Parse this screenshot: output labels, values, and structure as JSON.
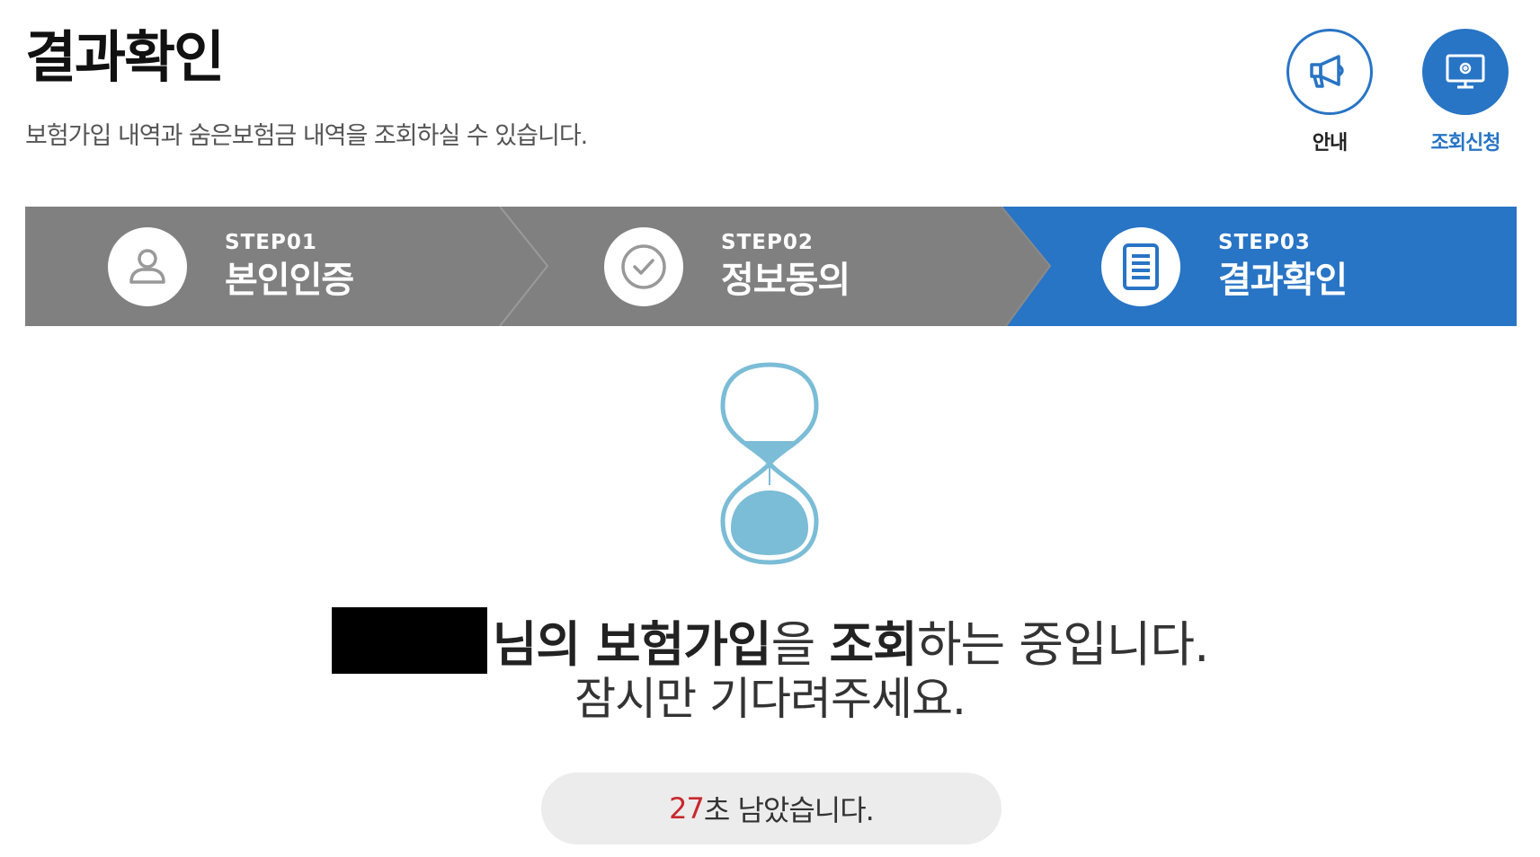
{
  "header": {
    "title": "결과확인",
    "subtitle": "보험가입 내역과 숨은보험금 내역을 조회하실 수 있습니다."
  },
  "top_buttons": {
    "guide": {
      "label": "안내",
      "icon": "megaphone-icon"
    },
    "request": {
      "label": "조회신청",
      "icon": "monitor-gear-icon"
    }
  },
  "steps": [
    {
      "number": "STEP01",
      "name": "본인인증",
      "icon": "person-icon",
      "state": "done"
    },
    {
      "number": "STEP02",
      "name": "정보동의",
      "icon": "check-circle-icon",
      "state": "done"
    },
    {
      "number": "STEP03",
      "name": "결과확인",
      "icon": "document-icon",
      "state": "active"
    }
  ],
  "colors": {
    "step_inactive": "#808080",
    "step_active": "#2874c5",
    "accent": "#2874c5",
    "countdown_number": "#c8282d",
    "hourglass": "#7bbcd6"
  },
  "status": {
    "name_suffix": "님의 ",
    "bold1": "보험가입",
    "text2": "을 ",
    "bold2": "조회",
    "text3": "하는 중입니다.",
    "line2": "잠시만 기다려주세요."
  },
  "countdown": {
    "seconds": "27",
    "suffix": "초 남았습니다."
  }
}
